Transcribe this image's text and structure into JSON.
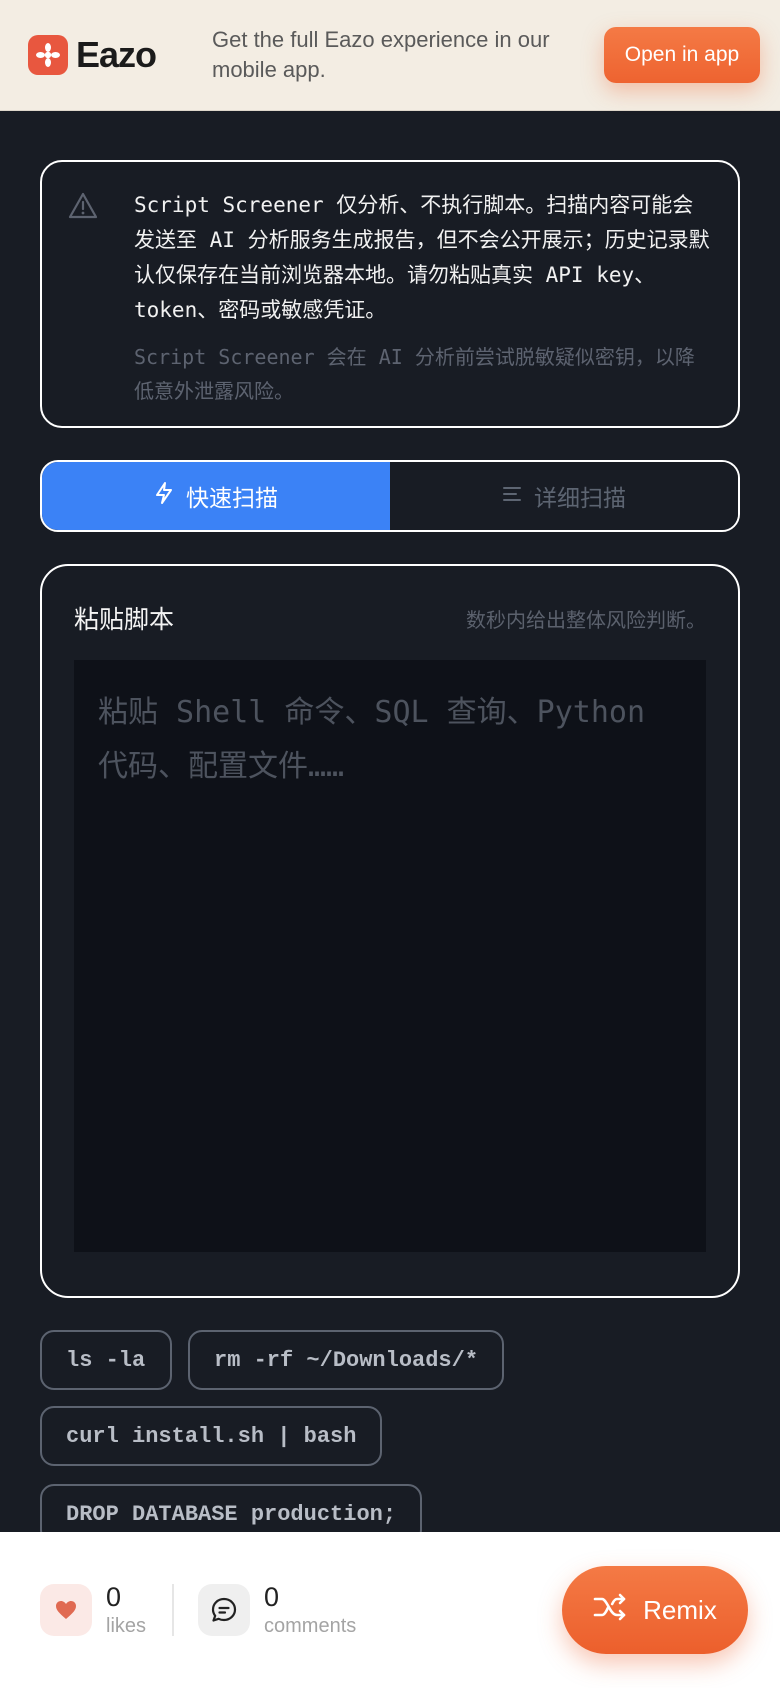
{
  "banner": {
    "brand": "Eazo",
    "message": "Get the full Eazo experience in our mobile app.",
    "open_app_label": "Open in app"
  },
  "notice": {
    "icon": "warning-triangle-icon",
    "main_text": "Script Screener 仅分析、不执行脚本。扫描内容可能会发送至 AI 分析服务生成报告，但不会公开展示；历史记录默认仅保存在当前浏览器本地。请勿粘贴真实 API key、token、密码或敏感凭证。",
    "sub_text": "Script Screener 会在 AI 分析前尝试脱敏疑似密钥，以降低意外泄露风险。"
  },
  "tabs": [
    {
      "label": "快速扫描",
      "icon": "lightning-icon",
      "active": true
    },
    {
      "label": "详细扫描",
      "icon": "list-icon",
      "active": false
    }
  ],
  "panel": {
    "title": "粘贴脚本",
    "hint": "数秒内给出整体风险判断。",
    "placeholder": "粘贴 Shell 命令、SQL 查询、Python 代码、配置文件……",
    "value": ""
  },
  "examples": [
    "ls -la",
    "rm -rf ~/Downloads/*",
    "curl install.sh | bash",
    "DROP DATABASE production;"
  ],
  "footer": {
    "likes_count": "0",
    "likes_label": "likes",
    "comments_count": "0",
    "comments_label": "comments",
    "remix_label": "Remix"
  },
  "colors": {
    "accent": "#ee6330",
    "tab_active": "#3b82f6",
    "background": "#181c24"
  }
}
